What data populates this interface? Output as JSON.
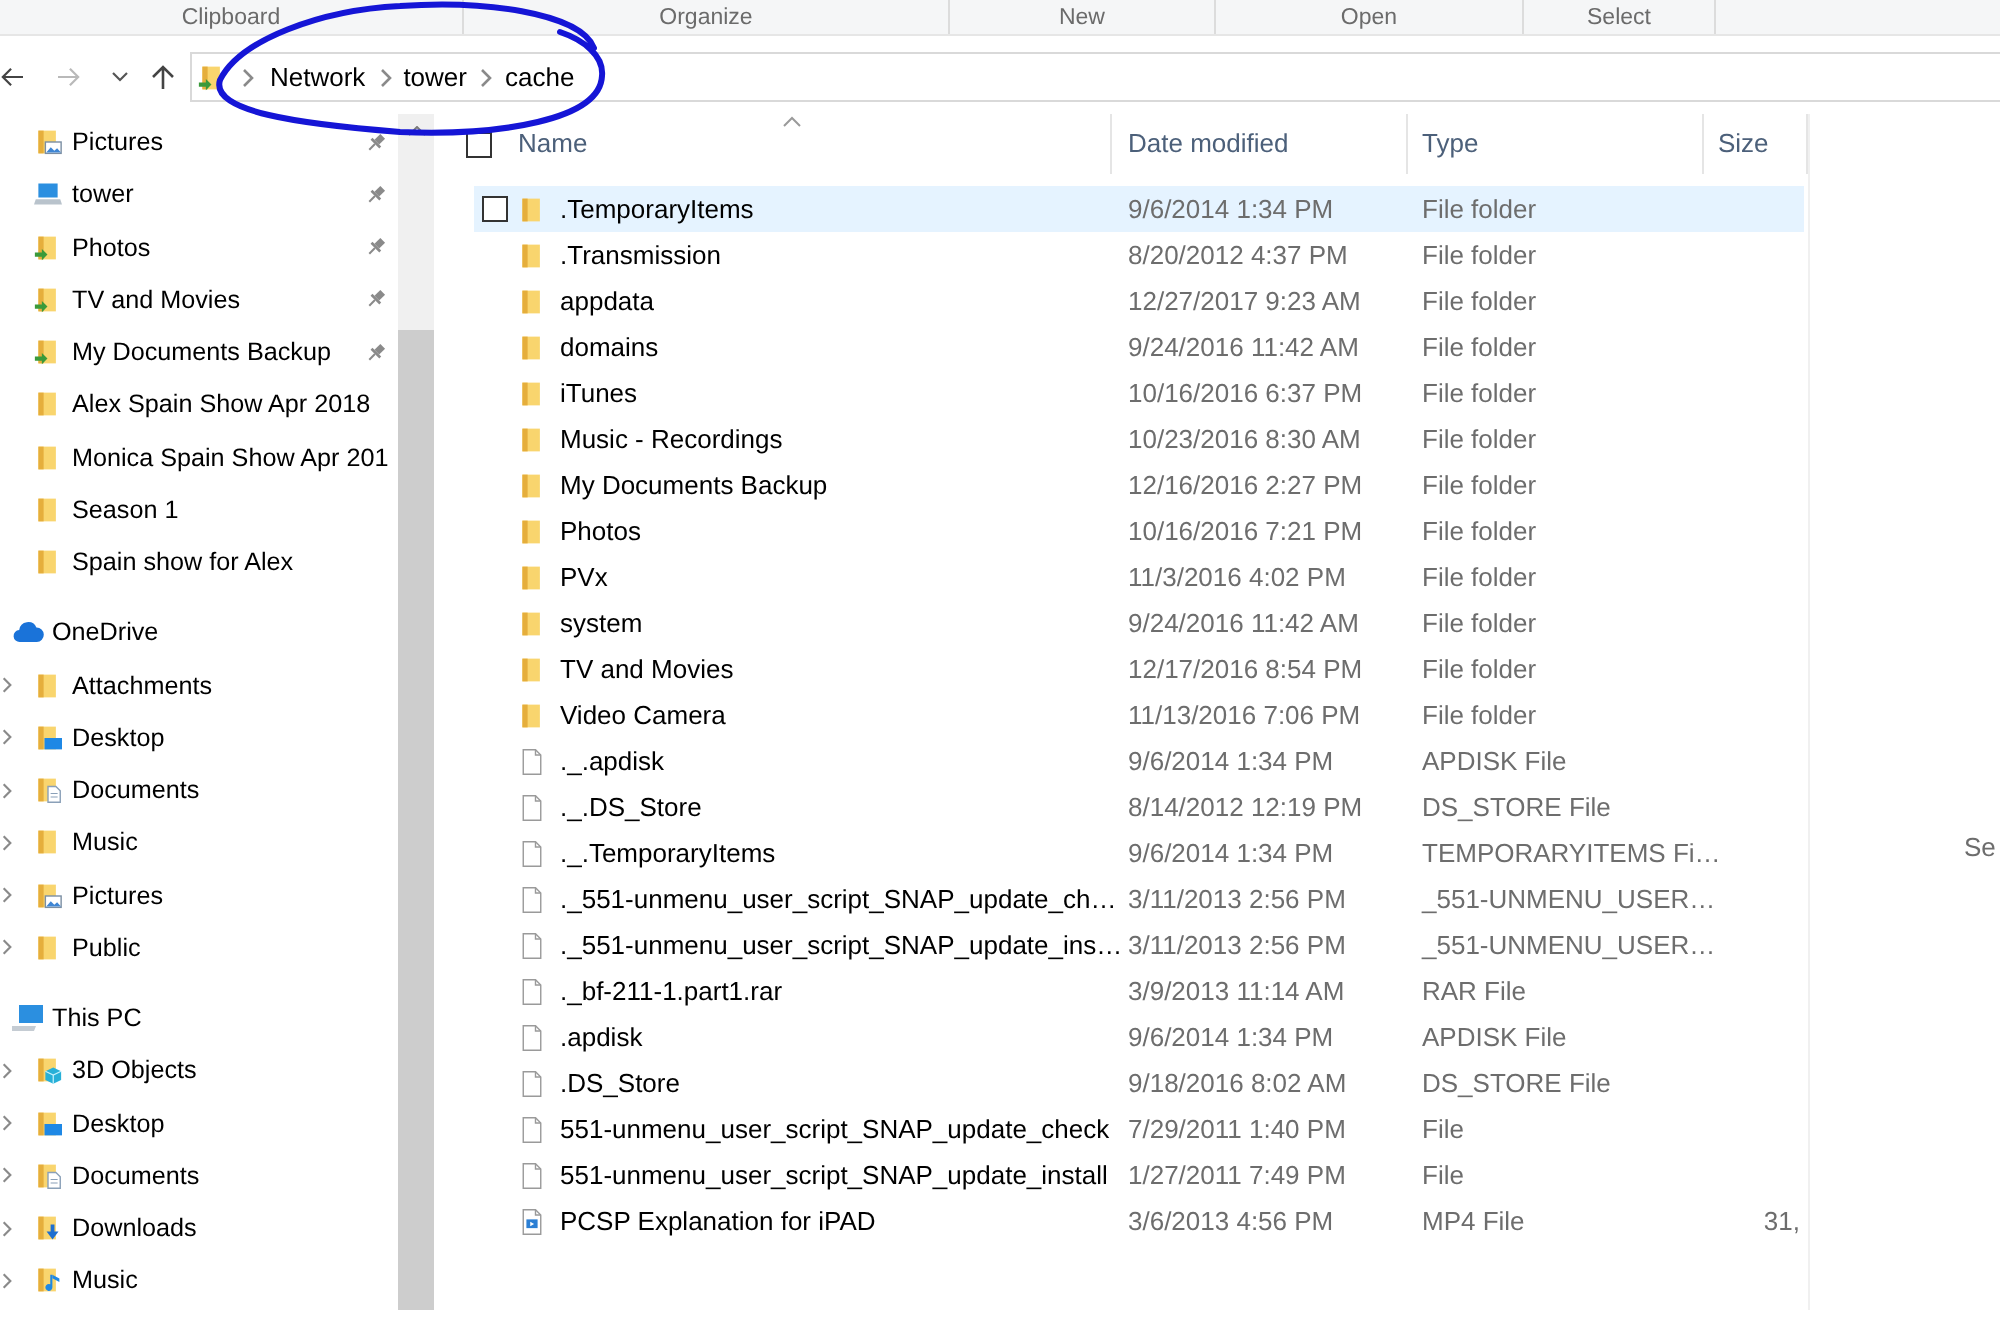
{
  "ribbon_groups": [
    "Clipboard",
    "Organize",
    "New",
    "Open",
    "Select"
  ],
  "address_bar": {
    "path": [
      "Network",
      "tower",
      "cache"
    ]
  },
  "annotation": {
    "kind": "ellipse"
  },
  "sidebar": {
    "quick_access": [
      {
        "label": "Pictures",
        "kind": "pictures-folder",
        "pinned": true
      },
      {
        "label": "tower",
        "kind": "computer",
        "pinned": true
      },
      {
        "label": "Photos",
        "kind": "shortcut-folder",
        "pinned": true
      },
      {
        "label": "TV and Movies",
        "kind": "shortcut-folder",
        "pinned": true
      },
      {
        "label": "My Documents Backup",
        "kind": "shortcut-folder",
        "pinned": true
      },
      {
        "label": "Alex Spain Show Apr 2018",
        "kind": "folder",
        "pinned": false
      },
      {
        "label": "Monica Spain Show Apr 201",
        "kind": "folder",
        "pinned": false
      },
      {
        "label": "Season 1",
        "kind": "folder",
        "pinned": false
      },
      {
        "label": "Spain show for Alex",
        "kind": "folder",
        "pinned": false
      }
    ],
    "locations": [
      {
        "label": "OneDrive",
        "kind": "cloud",
        "children": [
          {
            "label": "Attachments",
            "kind": "folder",
            "expandable": true
          },
          {
            "label": "Desktop",
            "kind": "desktop-folder",
            "expandable": true
          },
          {
            "label": "Documents",
            "kind": "documents-folder",
            "expandable": true
          },
          {
            "label": "Music",
            "kind": "folder",
            "expandable": true
          },
          {
            "label": "Pictures",
            "kind": "pictures-folder",
            "expandable": true
          },
          {
            "label": "Public",
            "kind": "folder",
            "expandable": true
          }
        ]
      },
      {
        "label": "This PC",
        "kind": "monitor",
        "children": [
          {
            "label": "3D Objects",
            "kind": "cube-folder",
            "expandable": true
          },
          {
            "label": "Desktop",
            "kind": "desktop-folder",
            "expandable": true
          },
          {
            "label": "Documents",
            "kind": "documents-folder",
            "expandable": true
          },
          {
            "label": "Downloads",
            "kind": "downloads-folder",
            "expandable": true
          },
          {
            "label": "Music",
            "kind": "music-folder",
            "expandable": true
          }
        ]
      }
    ]
  },
  "file_list": {
    "select_all": {
      "checked": false
    },
    "columns": [
      {
        "label": "Name",
        "sorted": true
      },
      {
        "label": "Date modified",
        "sorted": false
      },
      {
        "label": "Type",
        "sorted": false
      },
      {
        "label": "Size",
        "sorted": false
      }
    ],
    "rows": [
      {
        "name": ".TemporaryItems",
        "date_modified": "9/6/2014 1:34 PM",
        "type": "File folder",
        "kind": "folder",
        "highlighted": true
      },
      {
        "name": ".Transmission",
        "date_modified": "8/20/2012 4:37 PM",
        "type": "File folder",
        "kind": "folder",
        "highlighted": false
      },
      {
        "name": "appdata",
        "date_modified": "12/27/2017 9:23 AM",
        "type": "File folder",
        "kind": "folder",
        "highlighted": false
      },
      {
        "name": "domains",
        "date_modified": "9/24/2016 11:42 AM",
        "type": "File folder",
        "kind": "folder",
        "highlighted": false
      },
      {
        "name": "iTunes",
        "date_modified": "10/16/2016 6:37 PM",
        "type": "File folder",
        "kind": "folder",
        "highlighted": false
      },
      {
        "name": "Music - Recordings",
        "date_modified": "10/23/2016 8:30 AM",
        "type": "File folder",
        "kind": "folder",
        "highlighted": false
      },
      {
        "name": "My Documents Backup",
        "date_modified": "12/16/2016 2:27 PM",
        "type": "File folder",
        "kind": "folder",
        "highlighted": false
      },
      {
        "name": "Photos",
        "date_modified": "10/16/2016 7:21 PM",
        "type": "File folder",
        "kind": "folder",
        "highlighted": false
      },
      {
        "name": "PVx",
        "date_modified": "11/3/2016 4:02 PM",
        "type": "File folder",
        "kind": "folder",
        "highlighted": false
      },
      {
        "name": "system",
        "date_modified": "9/24/2016 11:42 AM",
        "type": "File folder",
        "kind": "folder",
        "highlighted": false
      },
      {
        "name": "TV and Movies",
        "date_modified": "12/17/2016 8:54 PM",
        "type": "File folder",
        "kind": "folder",
        "highlighted": false
      },
      {
        "name": "Video Camera",
        "date_modified": "11/13/2016 7:06 PM",
        "type": "File folder",
        "kind": "folder",
        "highlighted": false
      },
      {
        "name": "._.apdisk",
        "date_modified": "9/6/2014 1:34 PM",
        "type": "APDISK File",
        "kind": "file",
        "highlighted": false
      },
      {
        "name": "._.DS_Store",
        "date_modified": "8/14/2012 12:19 PM",
        "type": "DS_STORE File",
        "kind": "file",
        "highlighted": false
      },
      {
        "name": "._.TemporaryItems",
        "date_modified": "9/6/2014 1:34 PM",
        "type": "TEMPORARYITEMS Fi…",
        "kind": "file",
        "highlighted": false
      },
      {
        "name": "._551-unmenu_user_script_SNAP_update_ch…",
        "date_modified": "3/11/2013 2:56 PM",
        "type": "_551-UNMENU_USER…",
        "kind": "file",
        "highlighted": false
      },
      {
        "name": "._551-unmenu_user_script_SNAP_update_ins…",
        "date_modified": "3/11/2013 2:56 PM",
        "type": "_551-UNMENU_USER…",
        "kind": "file",
        "highlighted": false
      },
      {
        "name": "._bf-211-1.part1.rar",
        "date_modified": "3/9/2013 11:14 AM",
        "type": "RAR File",
        "kind": "file",
        "highlighted": false
      },
      {
        "name": ".apdisk",
        "date_modified": "9/6/2014 1:34 PM",
        "type": "APDISK File",
        "kind": "file",
        "highlighted": false
      },
      {
        "name": ".DS_Store",
        "date_modified": "9/18/2016 8:02 AM",
        "type": "DS_STORE File",
        "kind": "file",
        "highlighted": false
      },
      {
        "name": "551-unmenu_user_script_SNAP_update_check",
        "date_modified": "7/29/2011 1:40 PM",
        "type": "File",
        "kind": "file",
        "highlighted": false
      },
      {
        "name": "551-unmenu_user_script_SNAP_update_install",
        "date_modified": "1/27/2011 7:49 PM",
        "type": "File",
        "kind": "file",
        "highlighted": false
      },
      {
        "name": "PCSP Explanation for iPAD",
        "date_modified": "3/6/2013 4:56 PM",
        "type": "MP4 File",
        "size": "31,",
        "kind": "video",
        "highlighted": false
      }
    ]
  },
  "preview_pane": {
    "message": "Se"
  }
}
